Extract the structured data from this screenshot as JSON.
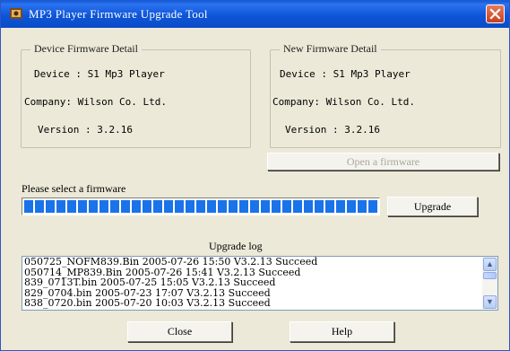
{
  "window": {
    "title": "MP3 Player Firmware Upgrade Tool"
  },
  "device": {
    "group_title": "Device Firmware Detail",
    "device_label": "Device : S1 Mp3 Player",
    "company_label": "Company: Wilson Co. Ltd.",
    "version_label": "Version : 3.2.16"
  },
  "new_firmware": {
    "group_title": "New Firmware Detail",
    "device_label": "Device : S1 Mp3 Player",
    "company_label": "Company: Wilson Co. Ltd.",
    "version_label": "Version : 3.2.16",
    "open_button": "Open a firmware"
  },
  "select": {
    "prompt": "Please select a firmware",
    "progress_fraction": 1.0,
    "upgrade_button": "Upgrade"
  },
  "log": {
    "title": "Upgrade log",
    "lines": [
      "050725_NOFM839.Bin   2005-07-26   15:50   V3.2.13 Succeed",
      "050714_MP839.Bin   2005-07-26   15:41   V3.2.13 Succeed",
      "839_0713T.bin   2005-07-25   15:05   V3.2.13 Succeed",
      "829_0704.bin   2005-07-23   17:07   V3.2.13 Succeed",
      "838_0720.bin   2005-07-20   10:03   V3.2.13 Succeed"
    ]
  },
  "footer": {
    "close_button": "Close",
    "help_button": "Help"
  },
  "colors": {
    "title_bar": "#0a5bdc",
    "progress": "#1a73e8",
    "dialog_bg": "#ece9d8"
  }
}
